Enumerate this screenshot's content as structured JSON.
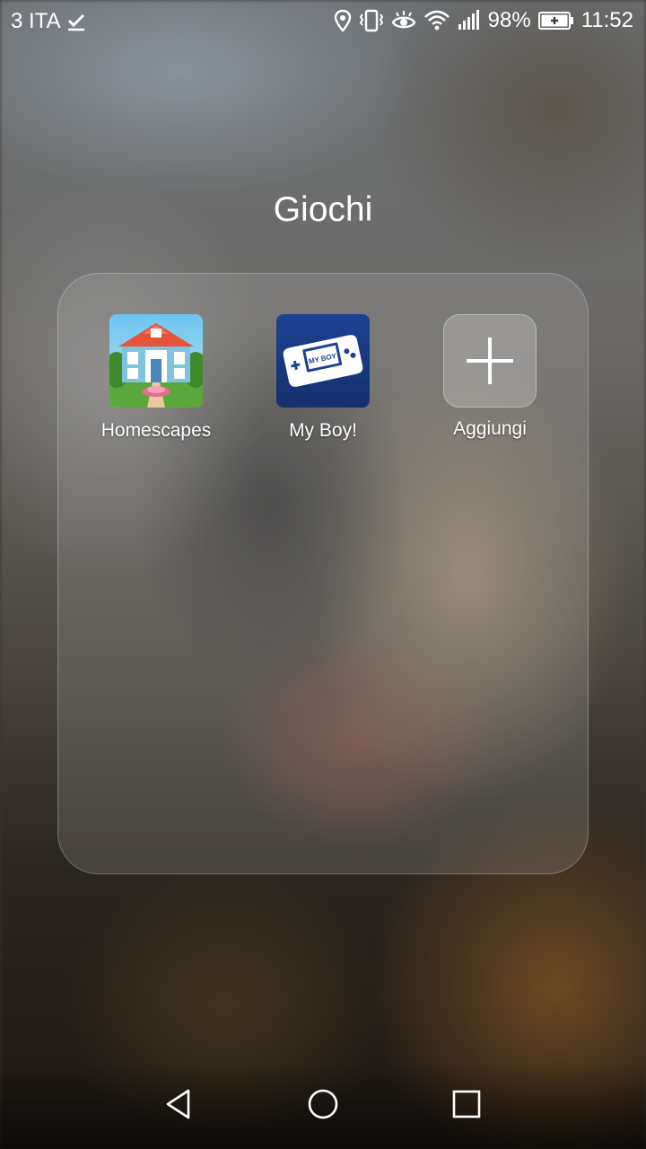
{
  "status_bar": {
    "carrier": "3 ITA",
    "battery_percent": "98%",
    "time": "11:52",
    "icons": [
      "checkmark-icon",
      "location-icon",
      "vibrate-icon",
      "eye-comfort-icon",
      "wifi-icon",
      "signal-icon",
      "battery-charging-icon"
    ]
  },
  "folder": {
    "title": "Giochi",
    "apps": [
      {
        "label": "Homescapes",
        "icon": "homescapes-icon"
      },
      {
        "label": "My Boy!",
        "icon": "my-boy-icon",
        "icon_text": "MY BOY"
      },
      {
        "label": "Aggiungi",
        "icon": "plus-icon"
      }
    ]
  },
  "nav_bar": {
    "buttons": [
      "back-icon",
      "home-icon",
      "recents-icon"
    ]
  },
  "colors": {
    "text": "#ffffff",
    "my_boy_bg": "#1c3f8c"
  }
}
